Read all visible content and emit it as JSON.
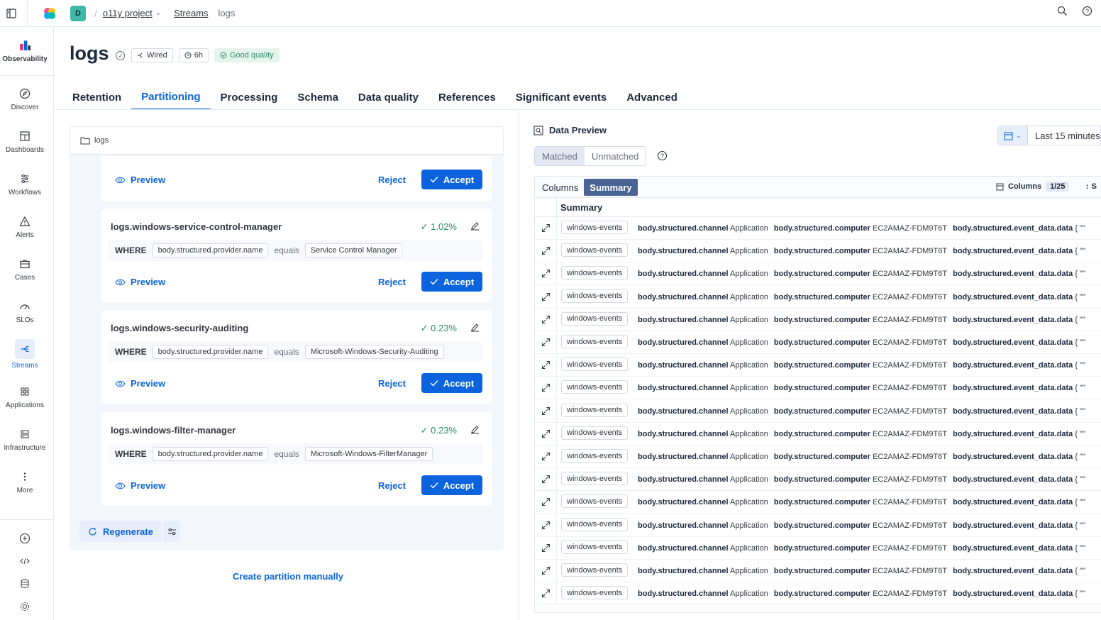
{
  "header": {
    "space_initial": "D",
    "breadcrumbs": [
      "o11y project",
      "Streams",
      "logs"
    ]
  },
  "nav": {
    "items": [
      {
        "label": "Observability",
        "icon": "observability-icon"
      },
      {
        "label": "Discover",
        "icon": "compass-icon"
      },
      {
        "label": "Dashboards",
        "icon": "dashboard-icon"
      },
      {
        "label": "Workflows",
        "icon": "workflow-icon"
      },
      {
        "label": "Alerts",
        "icon": "warning-icon"
      },
      {
        "label": "Cases",
        "icon": "briefcase-icon"
      },
      {
        "label": "SLOs",
        "icon": "gauge-icon"
      },
      {
        "label": "Streams",
        "icon": "streams-icon"
      },
      {
        "label": "Applications",
        "icon": "apps-icon"
      },
      {
        "label": "Infrastructure",
        "icon": "infrastructure-icon"
      },
      {
        "label": "More",
        "icon": "more-icon"
      }
    ],
    "active": "Streams"
  },
  "page": {
    "title": "logs",
    "tags": {
      "wired": "Wired",
      "retention": "6h",
      "quality": "Good quality"
    }
  },
  "tabs": [
    "Retention",
    "Partitioning",
    "Processing",
    "Schema",
    "Data quality",
    "References",
    "Significant events",
    "Advanced"
  ],
  "active_tab": "Partitioning",
  "partition_panel": {
    "root": "logs",
    "where_label": "WHERE",
    "equals_label": "equals",
    "preview_label": "Preview",
    "reject_label": "Reject",
    "accept_label": "Accept",
    "regenerate_label": "Regenerate",
    "create_manual_label": "Create partition manually",
    "suggestions": [
      {
        "name": "logs.windows-service-control-manager",
        "pct": "1.02%",
        "field": "body.structured.provider.name",
        "value": "Service Control Manager"
      },
      {
        "name": "logs.windows-security-auditing",
        "pct": "0.23%",
        "field": "body.structured.provider.name",
        "value": "Microsoft-Windows-Security-Auditing"
      },
      {
        "name": "logs.windows-filter-manager",
        "pct": "0.23%",
        "field": "body.structured.provider.name",
        "value": "Microsoft-Windows-FilterManager"
      }
    ]
  },
  "data_preview": {
    "title": "Data Preview",
    "time_range": "Last 15 minutes",
    "filter": {
      "matched": "Matched",
      "unmatched": "Unmatched"
    },
    "view_toggle": {
      "columns": "Columns",
      "summary": "Summary"
    },
    "columns_label": "Columns",
    "columns_count": "1/25",
    "sort_label": "S",
    "summary_header": "Summary",
    "row_stream": "windows-events",
    "row_fields": [
      {
        "key": "body.structured.channel",
        "value": "Application"
      },
      {
        "key": "body.structured.computer",
        "value": "EC2AMAZ-FDM9T6T"
      },
      {
        "key": "body.structured.event_data.data",
        "value": "{ \"\""
      }
    ],
    "row_count": 17
  },
  "colors": {
    "accent": "#0b64dd",
    "success": "#2d8c6a",
    "summary_tab": "#4a6595"
  }
}
